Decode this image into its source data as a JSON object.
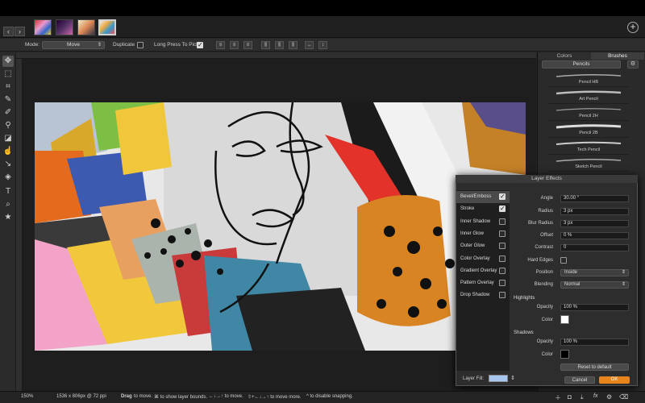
{
  "toolbar_options": {
    "mode_label": "Mode:",
    "mode_value": "Move",
    "duplicate_label": "Duplicate",
    "duplicate_checked": false,
    "long_press_label": "Long Press To Pick",
    "long_press_checked": true
  },
  "right_panel": {
    "tab_colors": "Colors",
    "tab_brushes": "Brushes",
    "brush_category": "Pencils",
    "brushes": [
      "Pencil HB",
      "Art Pencil",
      "Pencil 2H",
      "Pencil 2B",
      "Tech Pencil",
      "Sketch Pencil"
    ]
  },
  "layer_effects": {
    "title": "Layer Effects",
    "effects": [
      {
        "label": "Bevel/Emboss",
        "checked": true
      },
      {
        "label": "Stroke",
        "checked": true
      },
      {
        "label": "Inner Shadow",
        "checked": false
      },
      {
        "label": "Inner Glow",
        "checked": false
      },
      {
        "label": "Outer Glow",
        "checked": false
      },
      {
        "label": "Color Overlay",
        "checked": false
      },
      {
        "label": "Gradient Overlay",
        "checked": false
      },
      {
        "label": "Pattern Overlay",
        "checked": false
      },
      {
        "label": "Drop Shadow",
        "checked": false
      }
    ],
    "params": {
      "angle_label": "Angle",
      "angle_value": "30.00 °",
      "radius_label": "Radius",
      "radius_value": "3 px",
      "blur_label": "Blur Radius",
      "blur_value": "3 px",
      "offset_label": "Offset",
      "offset_value": "0 %",
      "contrast_label": "Contrast",
      "contrast_value": "0",
      "hard_edges_label": "Hard Edges",
      "position_label": "Position",
      "position_value": "Inside",
      "blending_label": "Blending",
      "blending_value": "Normal"
    },
    "highlights": {
      "title": "Highlights",
      "opacity_label": "Opacity",
      "opacity_value": "100 %",
      "color_label": "Color",
      "color": "#ffffff"
    },
    "shadows": {
      "title": "Shadows",
      "opacity_label": "Opacity",
      "opacity_value": "100 %",
      "color_label": "Color",
      "color": "#000000"
    },
    "reset_label": "Reset to default",
    "layer_fill_label": "Layer Fill:",
    "cancel_label": "Cancel",
    "ok_label": "OK",
    "ok_color": "#e8841c"
  },
  "status": {
    "zoom": "150%",
    "size": "1536 x 806px @ 72 ppi",
    "drag_bold": "Drag",
    "drag_rest": "to move.",
    "hint_bounds": "⌘ to show layer bounds.",
    "hint_arrows": "←↓→↑ to move.",
    "hint_shift": "⇧+←↓→↑ to move more.",
    "hint_snap": "^ to disable snapping."
  }
}
